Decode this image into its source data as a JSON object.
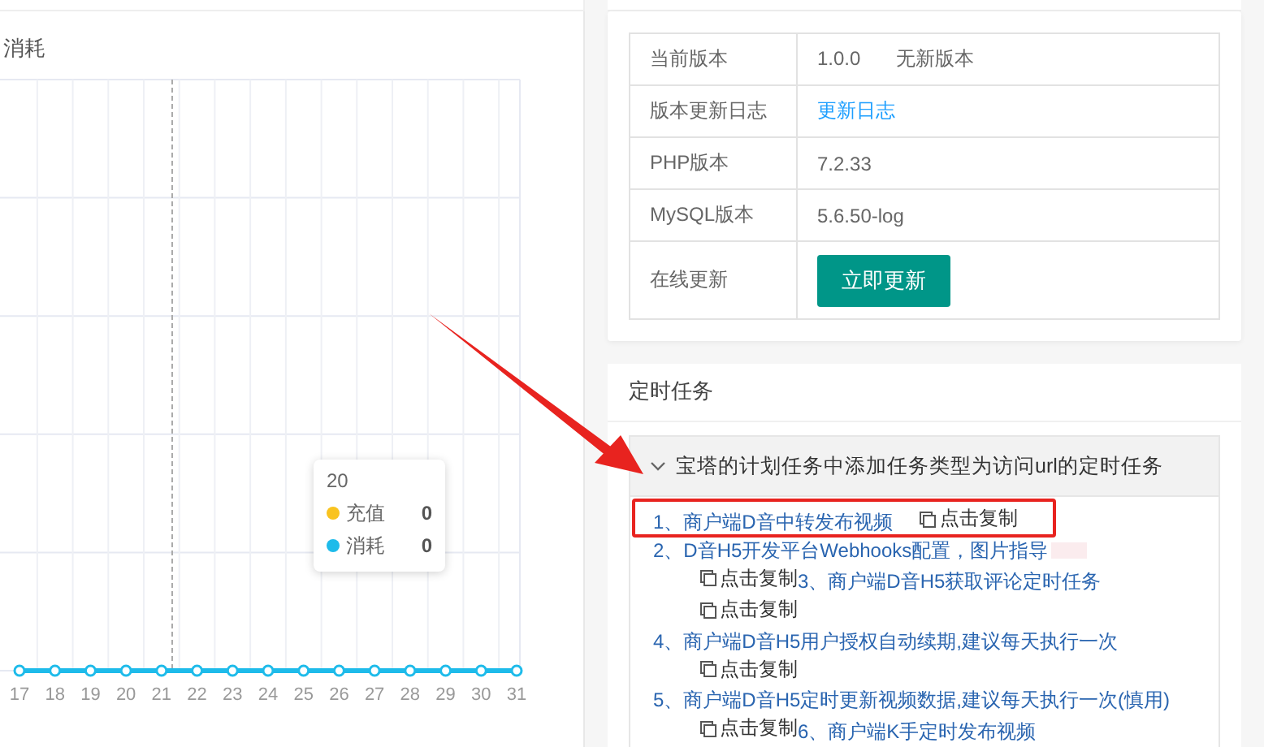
{
  "chart_panel": {
    "title": "消耗",
    "x_labels": [
      "17",
      "18",
      "19",
      "20",
      "21",
      "22",
      "23",
      "24",
      "25",
      "26",
      "27",
      "28",
      "29",
      "30",
      "31"
    ],
    "tooltip": {
      "title": "20",
      "rows": [
        {
          "name": "充值",
          "value": "0",
          "color": "#f9c31f"
        },
        {
          "name": "消耗",
          "value": "0",
          "color": "#1ebbea"
        }
      ]
    }
  },
  "version_panel": {
    "rows": [
      {
        "label": "当前版本",
        "kind": "text",
        "value": "1.0.0",
        "note": "无新版本"
      },
      {
        "label": "版本更新日志",
        "kind": "link",
        "value": "更新日志"
      },
      {
        "label": "PHP版本",
        "kind": "text",
        "value": "7.2.33"
      },
      {
        "label": "MySQL版本",
        "kind": "text",
        "value": "5.6.50-log"
      },
      {
        "label": "在线更新",
        "kind": "button",
        "value": "立即更新"
      }
    ]
  },
  "cron_panel": {
    "title": "定时任务",
    "section": {
      "title": "宝塔的计划任务中添加任务类型为访问url的定时任务",
      "expanded": true,
      "items": [
        {
          "text": "1、商户端D音中转发布视频",
          "copy": "点击复制",
          "highlighted": true
        },
        {
          "text": "2、D音H5开发平台Webhooks配置，图片指导",
          "copy": "点击复制",
          "has_image": true
        },
        {
          "text": "3、商户端D音H5获取评论定时任务",
          "copy": "点击复制"
        },
        {
          "text": "4、商户端D音H5用户授权自动续期,建议每天执行一次",
          "copy": "点击复制"
        },
        {
          "text": "5、商户端D音H5定时更新视频数据,建议每天执行一次(慎用)",
          "copy": "点击复制"
        },
        {
          "text": "6、商户端K手定时发布视频"
        }
      ]
    }
  }
}
